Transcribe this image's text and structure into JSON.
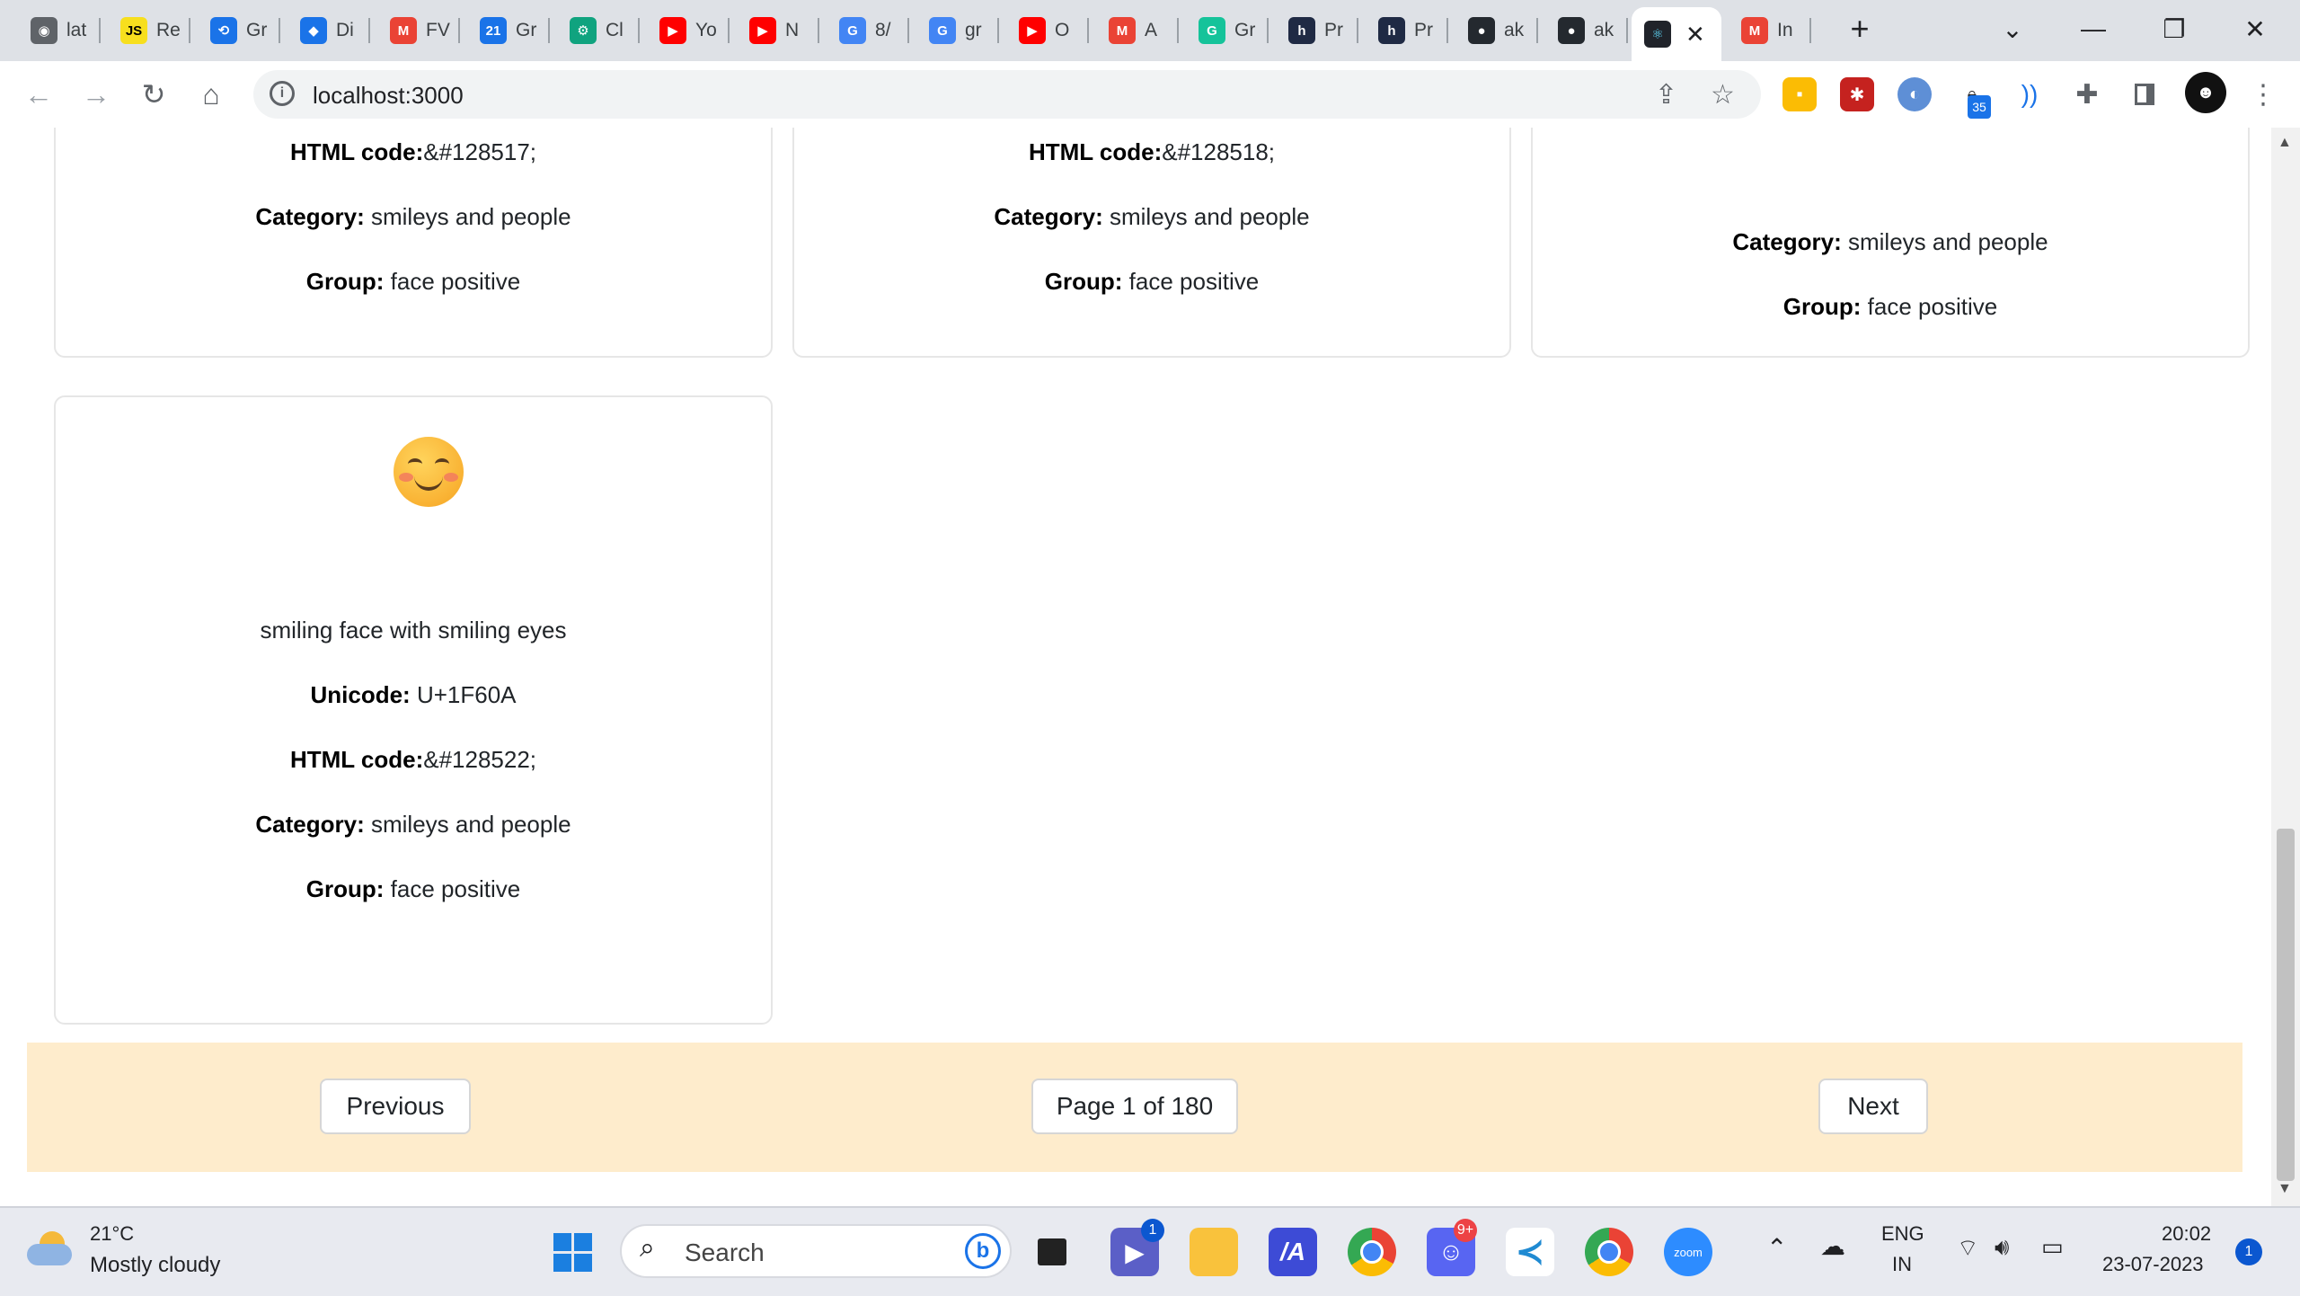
{
  "browser": {
    "tabs": [
      {
        "label": "lat",
        "icon": "chromium-icon",
        "color": "#5f6368"
      },
      {
        "label": "Re",
        "icon": "js-icon",
        "color": "#f7df1e"
      },
      {
        "label": "Gr",
        "icon": "link-icon",
        "color": "#1a73e8"
      },
      {
        "label": "Di",
        "icon": "gem-icon",
        "color": "#1a73e8"
      },
      {
        "label": "FV",
        "icon": "gmail-icon",
        "color": "#ea4335"
      },
      {
        "label": "Gr",
        "icon": "calendar-icon",
        "color": "#1a73e8"
      },
      {
        "label": "Cl",
        "icon": "chatgpt-icon",
        "color": "#10a37f"
      },
      {
        "label": "Yo",
        "icon": "youtube-icon",
        "color": "#ff0000"
      },
      {
        "label": "N",
        "icon": "youtube-icon",
        "color": "#ff0000"
      },
      {
        "label": "8/",
        "icon": "google-icon",
        "color": "#4285f4"
      },
      {
        "label": "gr",
        "icon": "google-icon",
        "color": "#4285f4"
      },
      {
        "label": "O",
        "icon": "youtube-icon",
        "color": "#ff0000"
      },
      {
        "label": "A",
        "icon": "gmail-icon",
        "color": "#ea4335"
      },
      {
        "label": "Gr",
        "icon": "grammarly-icon",
        "color": "#15c39a"
      },
      {
        "label": "Pr",
        "icon": "hashnode-icon",
        "color": "#1f2a44"
      },
      {
        "label": "Pr",
        "icon": "hashnode-icon",
        "color": "#1f2a44"
      },
      {
        "label": "ak",
        "icon": "github-icon",
        "color": "#24292f"
      },
      {
        "label": "ak",
        "icon": "github-icon",
        "color": "#24292f"
      }
    ],
    "active_tab": {
      "icon": "react-icon",
      "close": "✕"
    },
    "last_tab": {
      "label": "In",
      "icon": "gmail-icon"
    },
    "new_tab": "+",
    "url": "localhost:3000",
    "extension_badge": "35"
  },
  "cards_top": [
    {
      "html_label": "HTML code:",
      "html_value": "&#128517;",
      "category_label": "Category:",
      "category_value": " smileys and people",
      "group_label": "Group:",
      "group_value": " face positive"
    },
    {
      "html_label": "HTML code:",
      "html_value": "&#128518;",
      "category_label": "Category:",
      "category_value": " smileys and people",
      "group_label": "Group:",
      "group_value": " face positive"
    },
    {
      "category_label": "Category:",
      "category_value": " smileys and people",
      "group_label": "Group:",
      "group_value": " face positive"
    }
  ],
  "card_main": {
    "emoji": "smiling-face-with-smiling-eyes-icon",
    "name": "smiling face with smiling eyes",
    "unicode_label": "Unicode:",
    "unicode_value": " U+1F60A",
    "html_label": "HTML code:",
    "html_value": "&#128522;",
    "category_label": "Category:",
    "category_value": " smileys and people",
    "group_label": "Group:",
    "group_value": " face positive"
  },
  "pager": {
    "previous": "Previous",
    "page_info": "Page 1 of 180",
    "next": "Next",
    "background": "#feeccc"
  },
  "taskbar": {
    "weather_temp": "21°C",
    "weather_desc": "Mostly cloudy",
    "search_placeholder": "Search",
    "teams_badge": "1",
    "discord_badge": "9+",
    "zoom_label": "zoom",
    "language_line1": "ENG",
    "language_line2": "IN",
    "time": "20:02",
    "date": "23-07-2023",
    "notification_count": "1"
  }
}
